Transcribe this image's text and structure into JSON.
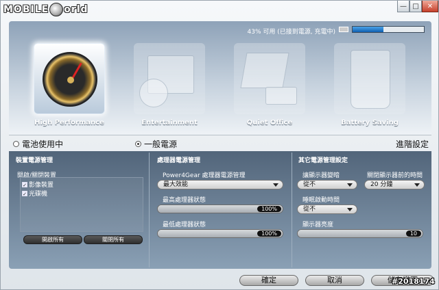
{
  "app": {
    "logo_left": "MOBILE",
    "logo_right": "orld"
  },
  "window_controls": {
    "minimize": "—",
    "maximize": "□",
    "close": "✕"
  },
  "battery": {
    "status_text": "43% 可用 (已接到電源, 充電中)",
    "percent": 43
  },
  "modes": [
    {
      "label": "High Performance",
      "icon": "gauge-icon",
      "active": true
    },
    {
      "label": "Entertainment",
      "icon": "clapperboard-icon",
      "active": false
    },
    {
      "label": "Quiet Office",
      "icon": "office-icon",
      "active": false
    },
    {
      "label": "Battery Saving",
      "icon": "trash-recycle-icon",
      "active": false
    }
  ],
  "power_source": {
    "battery_label": "電池使用中",
    "ac_label": "一般電源",
    "selected": "ac",
    "advanced_label": "進階設定"
  },
  "device_panel": {
    "title": "裝置電源管理",
    "group_label": "開啟/關閉裝置",
    "items": [
      {
        "label": "影像裝置",
        "checked": true
      },
      {
        "label": "光碟機",
        "checked": true
      }
    ],
    "enable_all": "開啟所有",
    "disable_all": "關閉所有"
  },
  "cpu_panel": {
    "title": "處理器電源管理",
    "p4g_label": "Power4Gear 處理器電源管理",
    "p4g_value": "最大效能",
    "max_label": "最高處理器狀態",
    "max_value": "100%",
    "max_level": 100,
    "min_label": "最低處理器狀態",
    "min_value": "100%",
    "min_level": 100
  },
  "other_panel": {
    "title": "其它電源管理設定",
    "dim_label": "讓顯示器變暗",
    "dim_value": "從不",
    "off_label": "關閉顯示器前的時間",
    "off_value": "20 分鐘",
    "sleep_label": "睡眠啟動時間",
    "sleep_value": "從不",
    "brightness_label": "顯示器亮度",
    "brightness_value": "10",
    "brightness_level": 100
  },
  "footer": {
    "ok": "確定",
    "cancel": "取消",
    "save": "儲存變更",
    "watermark": "#2018174"
  },
  "colors": {
    "accent": "#1060b0",
    "panel_dark": "#52657a"
  }
}
